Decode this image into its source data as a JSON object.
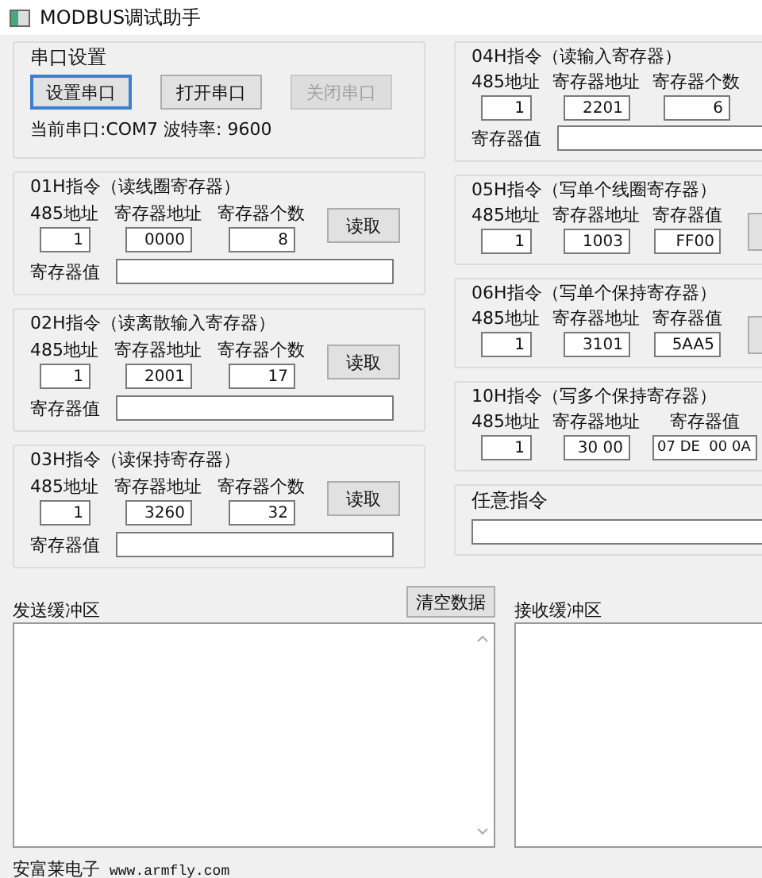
{
  "window": {
    "title": "MODBUS调试助手"
  },
  "serial": {
    "title": "串口设置",
    "buttons": [
      {
        "label": "设置串口",
        "focused": true,
        "disabled": false
      },
      {
        "label": "打开串口",
        "focused": false,
        "disabled": false
      },
      {
        "label": "关闭串口",
        "focused": false,
        "disabled": true
      }
    ],
    "status": "当前串口:COM7 波特率: 9600"
  },
  "left_groups": [
    {
      "title": "01H指令（读线圈寄存器）",
      "kind": "read",
      "fields": [
        {
          "label": "485地址",
          "value": "1"
        },
        {
          "label": "寄存器地址",
          "value": "0000"
        },
        {
          "label": "寄存器个数",
          "value": "8"
        }
      ],
      "button": "读取",
      "value_label": "寄存器值"
    },
    {
      "title": "02H指令（读离散输入寄存器）",
      "kind": "read",
      "fields": [
        {
          "label": "485地址",
          "value": "1"
        },
        {
          "label": "寄存器地址",
          "value": "2001"
        },
        {
          "label": "寄存器个数",
          "value": "17"
        }
      ],
      "button": "读取",
      "value_label": "寄存器值"
    },
    {
      "title": "03H指令（读保持寄存器）",
      "kind": "read",
      "fields": [
        {
          "label": "485地址",
          "value": "1"
        },
        {
          "label": "寄存器地址",
          "value": "3260"
        },
        {
          "label": "寄存器个数",
          "value": "32"
        }
      ],
      "button": "读取",
      "value_label": "寄存器值"
    }
  ],
  "right_groups": [
    {
      "title": "04H指令（读输入寄存器）",
      "kind": "read",
      "fields": [
        {
          "label": "485地址",
          "value": "1"
        },
        {
          "label": "寄存器地址",
          "value": "2201"
        },
        {
          "label": "寄存器个数",
          "value": "6"
        }
      ],
      "value_label": "寄存器值"
    },
    {
      "title": "05H指令（写单个线圈寄存器）",
      "kind": "write",
      "fields": [
        {
          "label": "485地址",
          "value": "1"
        },
        {
          "label": "寄存器地址",
          "value": "1003"
        },
        {
          "label": "寄存器值",
          "value": "FF00"
        }
      ]
    },
    {
      "title": "06H指令（写单个保持寄存器）",
      "kind": "write",
      "fields": [
        {
          "label": "485地址",
          "value": "1"
        },
        {
          "label": "寄存器地址",
          "value": "3101"
        },
        {
          "label": "寄存器值",
          "value": "5AA5"
        }
      ]
    },
    {
      "title": "10H指令（写多个保持寄存器）",
      "kind": "multi",
      "fields": [
        {
          "label": "485地址",
          "value": "1"
        },
        {
          "label": "寄存器地址",
          "value": "30 00"
        },
        {
          "label": "寄存器值",
          "value": "07 DE  00 0A"
        }
      ]
    },
    {
      "title": "任意指令",
      "kind": "free"
    }
  ],
  "send": {
    "label": "发送缓冲区",
    "clear_button": "清空数据"
  },
  "receive": {
    "label": "接收缓冲区"
  },
  "footer": {
    "company": "安富莱电子",
    "url": "www.armfly.com"
  }
}
